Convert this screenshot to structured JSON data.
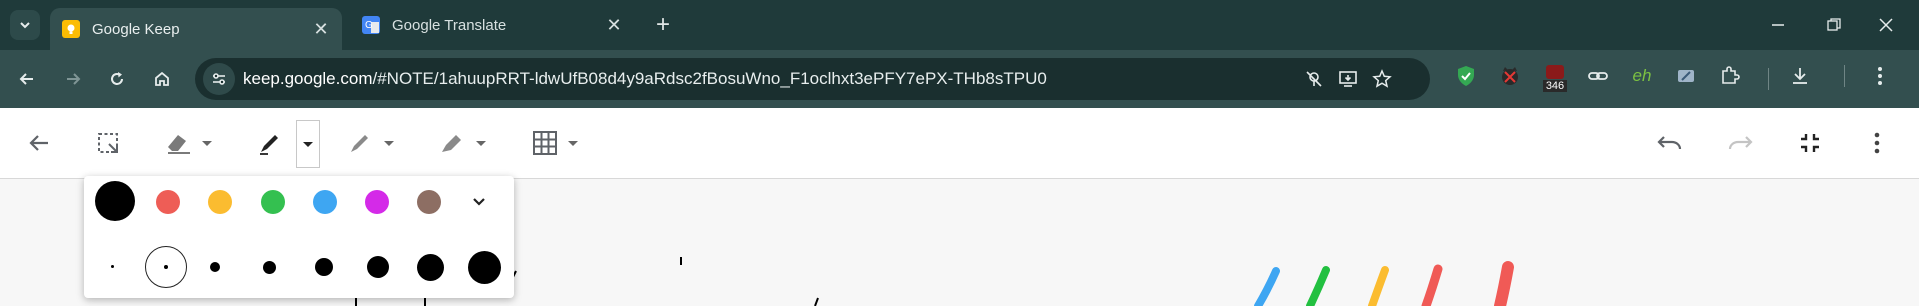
{
  "browser": {
    "tab_list_icon": "chevron-down-icon",
    "tabs": [
      {
        "title": "Google Keep",
        "favicon": "google-keep-icon",
        "color": "#fbbc04",
        "active": true
      },
      {
        "title": "Google Translate",
        "favicon": "google-translate-icon",
        "color": "#4285f4",
        "active": false
      }
    ],
    "new_tab_icon": "plus-icon",
    "window_controls": [
      "minimize-icon",
      "restore-icon",
      "close-icon"
    ],
    "url": {
      "host": "keep.google.com",
      "path": "/#NOTE/1ahuupRRT-ldwUfB08d4y9aRdsc2fBosuWno_F1oclhxt3ePFY7ePX-THb8sTPU0"
    },
    "extensions": {
      "badge_count": "346",
      "eh_label": "eh"
    }
  },
  "keep": {
    "toolbar_icons": [
      "back-arrow-icon",
      "lasso-select-icon",
      "eraser-icon",
      "pen-icon",
      "marker-icon",
      "highlighter-icon",
      "grid-icon",
      "undo-icon",
      "redo-icon",
      "exit-fullscreen-icon",
      "more-vert-icon"
    ],
    "palette": {
      "colors": [
        "#000000",
        "#ee5d56",
        "#fbbc30",
        "#34c050",
        "#3ea6f2",
        "#d42ae8",
        "#8d6e63"
      ],
      "selected_color": "#000000",
      "expand_icon": "chevron-down-icon",
      "sizes": [
        1,
        2,
        3,
        4,
        5,
        6,
        7,
        8
      ],
      "selected_size": 2
    }
  }
}
